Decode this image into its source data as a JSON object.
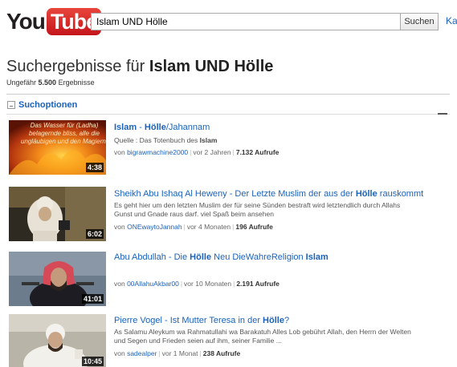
{
  "header": {
    "logo_you": "You",
    "logo_tube": "Tube",
    "search_value": "Islam UND Hölle",
    "search_button": "Suchen",
    "link_partial": "Ka"
  },
  "results_header": {
    "title_prefix": "Suchergebnisse für ",
    "query": "Islam UND Hölle",
    "count_prefix": "Ungefähr ",
    "count": "5.500",
    "count_suffix": " Ergebnisse",
    "options": "Suchoptionen"
  },
  "results": [
    {
      "title_parts": [
        {
          "text": "Islam",
          "bold": true
        },
        {
          "text": " - ",
          "bold": false
        },
        {
          "text": "Hölle",
          "bold": true
        },
        {
          "text": "/Jahannam",
          "bold": false
        }
      ],
      "desc_parts": [
        {
          "text": "Quelle : Das Totenbuch des ",
          "bold": false
        },
        {
          "text": "Islam",
          "bold": true
        }
      ],
      "desc_line2": "",
      "user": "bigrawmachine2000",
      "age": "vor 2 Jahren",
      "views": "7.132 Aufrufe",
      "duration": "4:38",
      "thumb_text": "Das Wasser für (Ladha) belagernde bliss, alle die ungläubigen und den Magiern."
    },
    {
      "title_parts": [
        {
          "text": "Sheikh Abu Ishaq Al Heweny - Der Letzte Muslim der aus der ",
          "bold": false
        },
        {
          "text": "Hölle",
          "bold": true
        },
        {
          "text": " rauskommt",
          "bold": false
        }
      ],
      "desc_parts": [
        {
          "text": "Es geht hier um den letzten Muslim der für seine Sünden bestraft wird letztendlich durch Allahs",
          "bold": false
        }
      ],
      "desc_line2": "Gunst und Gnade raus darf. viel Spaß beim ansehen",
      "user": "ONEwaytoJannah",
      "age": "vor 4 Monaten",
      "views": "196 Aufrufe",
      "duration": "6:02",
      "thumb_text": ""
    },
    {
      "title_parts": [
        {
          "text": "Abu Abdullah - Die ",
          "bold": false
        },
        {
          "text": "Hölle",
          "bold": true
        },
        {
          "text": " Neu DieWahreReligion ",
          "bold": false
        },
        {
          "text": "Islam",
          "bold": true
        }
      ],
      "desc_parts": [],
      "desc_line2": "",
      "user": "00AllahuAkbar00",
      "age": "vor 10 Monaten",
      "views": "2.191 Aufrufe",
      "duration": "41:01",
      "thumb_text": ""
    },
    {
      "title_parts": [
        {
          "text": "Pierre Vogel - Ist Mutter Teresa in der ",
          "bold": false
        },
        {
          "text": "Hölle",
          "bold": true
        },
        {
          "text": "?",
          "bold": false
        }
      ],
      "desc_parts": [
        {
          "text": "As Salamu Aleykum wa Rahmatullahi wa Barakatuh Alles Lob gebührt Allah, den Herrn der Welten",
          "bold": false
        }
      ],
      "desc_line2": "und Segen und Frieden seien auf ihm, seiner Familie ...",
      "user": "sadealper",
      "age": "vor 1 Monat",
      "views": "238 Aufrufe",
      "duration": "10:45",
      "thumb_text": ""
    }
  ],
  "by_label": "von ",
  "colors": {
    "link": "#1c62b9",
    "logo_red": "#d8292f"
  }
}
